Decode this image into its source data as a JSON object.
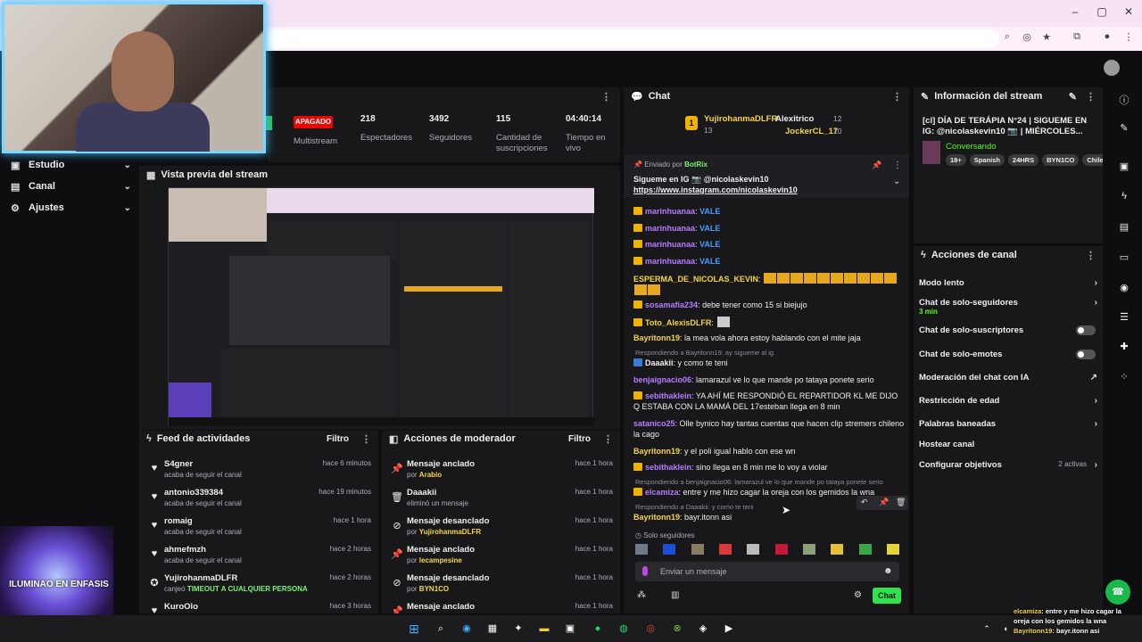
{
  "nav": {
    "items": [
      {
        "label": "Estudio"
      },
      {
        "label": "Canal"
      },
      {
        "label": "Ajustes"
      }
    ]
  },
  "stats": {
    "status_badge": "APAGADO",
    "multistream_label": "Multistream",
    "items": [
      {
        "value": "218",
        "label": "Espectadores"
      },
      {
        "value": "3492",
        "label": "Seguidores"
      },
      {
        "value": "115",
        "label": "Cantidad de suscripciones"
      },
      {
        "value": "04:40:14",
        "label": "Tiempo en vivo"
      }
    ]
  },
  "preview": {
    "title": "Vista previa del stream"
  },
  "feed": {
    "title": "Feed de actividades",
    "filter_label": "Filtro",
    "rows": [
      {
        "name": "S4gner",
        "desc": "acaba de seguir el canal",
        "time": "hace 6 minutos"
      },
      {
        "name": "antonio339384",
        "desc": "acaba de seguir el canal",
        "time": "hace 19 minutos"
      },
      {
        "name": "romaig",
        "desc": "acaba de seguir el canal",
        "time": "hace 1 hora"
      },
      {
        "name": "ahmefmzh",
        "desc": "acaba de seguir el canal",
        "time": "hace 2 horas"
      },
      {
        "name": "YujirohanmaDLFR",
        "desc_prefix": "canjeó",
        "desc": "TIMEOUT A CUALQUIER PERSONA",
        "time": "hace 2 horas"
      },
      {
        "name": "KuroOlo",
        "desc": "",
        "time": "hace 3 horas"
      }
    ]
  },
  "mod": {
    "title": "Acciones de moderador",
    "filter_label": "Filtro",
    "rows": [
      {
        "action": "Mensaje anclado",
        "prefix": "por",
        "by": "Arabio",
        "time": "hace 1 hora"
      },
      {
        "action": "Daaakii",
        "prefix": "",
        "by": "eliminó un mensaje",
        "time": "hace 1 hora"
      },
      {
        "action": "Mensaje desanclado",
        "prefix": "por",
        "by": "YujirohanmaDLFR",
        "time": "hace 1 hora"
      },
      {
        "action": "Mensaje anclado",
        "prefix": "por",
        "by": "lecampesine",
        "time": "hace 1 hora"
      },
      {
        "action": "Mensaje desanclado",
        "prefix": "por",
        "by": "BYN1CO",
        "time": "hace 1 hora"
      },
      {
        "action": "Mensaje anclado",
        "prefix": "",
        "by": "",
        "time": "hace 1 hora"
      }
    ]
  },
  "chat": {
    "title": "Chat",
    "leaderboard": [
      {
        "name": "YujirohanmaDLFR",
        "count": "13"
      },
      {
        "name": "Alexitrico",
        "count": "12"
      },
      {
        "name": "JockerCL_17",
        "count": "10"
      }
    ],
    "pinned": {
      "sent_by_label": "Enviado por",
      "sent_by": "BotRix",
      "line1": "Sigueme en IG 📷 @nicolaskevin10",
      "link": "https://www.instagram.com/nicolaskevin10"
    },
    "messages": [
      {
        "user": "marinhuanaa",
        "text": "",
        "emote": "VALE",
        "color": "#b57dff"
      },
      {
        "user": "marinhuanaa",
        "text": "",
        "emote": "VALE",
        "color": "#b57dff"
      },
      {
        "user": "marinhuanaa",
        "text": "",
        "emote": "VALE",
        "color": "#b57dff"
      },
      {
        "user": "marinhuanaa",
        "text": "",
        "emote": "VALE",
        "color": "#b57dff"
      },
      {
        "user": "ESPERMA_DE_NICOLAS_KEVIN",
        "text": "",
        "color": "#f5d547"
      },
      {
        "user": "sosamafia234",
        "text": "debe tener como 15 si biejujo",
        "color": "#b57dff"
      },
      {
        "user": "Toto_AlexisDLFR",
        "text": "",
        "color": "#f5d547"
      },
      {
        "user": "Bayritonn19",
        "text": "la mea vola ahora estoy hablando con el mite jaja",
        "color": "#f5d547"
      },
      {
        "user": "Daaakii",
        "text": "y como te teni",
        "reply": "Respondiendo a Bayritonn19: ay sigueme al ig",
        "color": "#efeff1"
      },
      {
        "user": "benjaignacio06",
        "text": "lamarazul ve lo que mande po tataya ponete serio",
        "color": "#b57dff"
      },
      {
        "user": "sebithaklein",
        "text": "YA AHÍ ME RESPONDIÓ EL REPARTIDOR KL ME DIJO Q ESTABA CON LA MAMÁ DEL 17esteban llega en 8 min",
        "color": "#b57dff"
      },
      {
        "user": "satanico25",
        "text": "Olle bynico hay tantas cuentas que hacen clip stremers chileno la cago",
        "color": "#b57dff"
      },
      {
        "user": "Bayritonn19",
        "text": "y el poli igual hablo con ese wn",
        "color": "#f5d547"
      },
      {
        "user": "sebithaklein",
        "text": "sino llega en 8 min me lo voy a violar",
        "color": "#b57dff"
      },
      {
        "user": "elcamiza",
        "text": "entre y me hizo cagar la oreja con los gemidos la wna",
        "reply": "Respondiendo a benjaignacio06: lamarazul ve lo que mande po tataya ponete serio",
        "color": "#b57dff"
      },
      {
        "user": "Bayritonn19",
        "text": "bayr.itonn asi",
        "reply": "Respondiendo a Daaakii: y como te teni",
        "color": "#f5d547"
      }
    ],
    "followers_only_label": "Solo seguidores",
    "input_placeholder": "Enviar un mensaje",
    "send_label": "Chat"
  },
  "info": {
    "title": "Información del stream",
    "stream_title": "[cl] DÍA DE TERÁPIA N°24 | SIGUEME EN IG: @nicolaskevin10 📷 | MIÉRCOLES...",
    "category": "Conversando",
    "tags": [
      "18+",
      "Spanish",
      "24HRS",
      "BYN1CO",
      "Chile"
    ]
  },
  "actions": {
    "title": "Acciones de canal",
    "items": [
      {
        "label": "Modo lento",
        "sub": "",
        "right": "chevron"
      },
      {
        "label": "Chat de solo-seguidores",
        "sub": "3 min",
        "right": "chevron"
      },
      {
        "label": "Chat de solo-suscriptores",
        "sub": "",
        "right": "toggle"
      },
      {
        "label": "Chat de solo-emotes",
        "sub": "",
        "right": "toggle"
      },
      {
        "label": "Moderación del chat con IA",
        "sub": "",
        "right": "external"
      },
      {
        "label": "Restricción de edad",
        "sub": "",
        "right": "chevron"
      },
      {
        "label": "Palabras baneadas",
        "sub": "",
        "right": "chevron"
      },
      {
        "label": "Hostear canal",
        "sub": "",
        "right": ""
      },
      {
        "label": "Configurar objetivos",
        "sub": "2 activas",
        "right": "chevron"
      }
    ]
  },
  "art": {
    "text": "ILUMINAO EN ENFASIS"
  },
  "overlay_chat": [
    {
      "user": "elcamiza",
      "text": "entre y me hizo cagar la oreja con los gemidos la wna"
    },
    {
      "user": "Bayritonn19",
      "text": "bayr.itonn asi"
    }
  ],
  "colors": {
    "accent_green": "#53fc18",
    "offline_red": "#eb0400",
    "panel": "#18181b",
    "bg": "#0e0e10"
  }
}
